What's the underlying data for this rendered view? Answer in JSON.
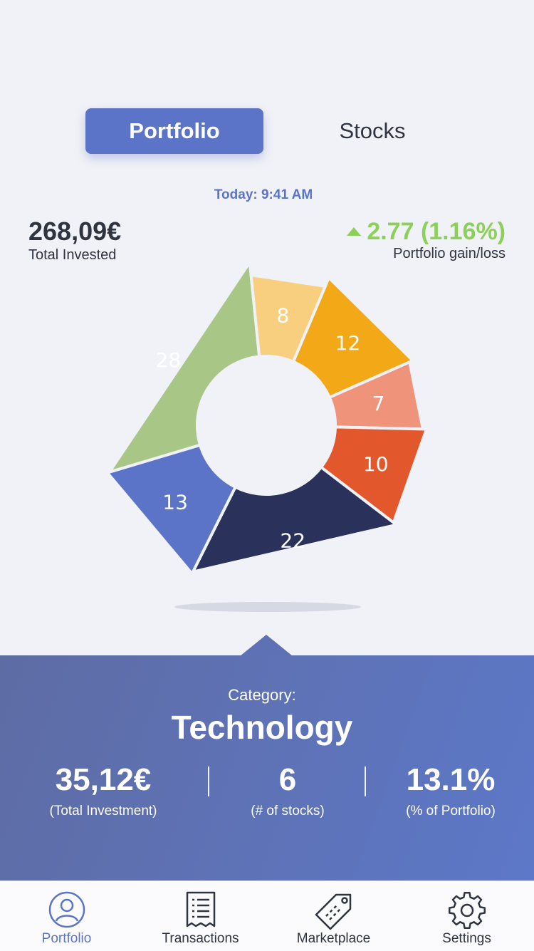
{
  "tabs": {
    "active": "Portfolio",
    "inactive": "Stocks"
  },
  "timestamp": "Today: 9:41 AM",
  "total": {
    "value": "268,09€",
    "label": "Total Invested"
  },
  "gain": {
    "value": "2.77 (1.16%)",
    "label": "Portfolio gain/loss",
    "color": "#8cd05a"
  },
  "chart_data": {
    "type": "pie",
    "style": "donut",
    "values": [
      12,
      7,
      10,
      22,
      13,
      28,
      8
    ],
    "colors": [
      "#f2a817",
      "#ef937b",
      "#e3572d",
      "#2a325c",
      "#5b74c8",
      "#a8c685",
      "#f8cf7f"
    ]
  },
  "category": {
    "label": "Category:",
    "name": "Technology",
    "stats": [
      {
        "value": "35,12€",
        "label": "(Total Investment)"
      },
      {
        "value": "6",
        "label": "(# of stocks)"
      },
      {
        "value": "13.1%",
        "label": "(% of Portfolio)"
      }
    ]
  },
  "nav": {
    "items": [
      {
        "label": "Portfolio",
        "icon": "user-icon",
        "active": true
      },
      {
        "label": "Transactions",
        "icon": "receipt-icon",
        "active": false
      },
      {
        "label": "Marketplace",
        "icon": "tag-icon",
        "active": false
      },
      {
        "label": "Settings",
        "icon": "gear-icon",
        "active": false
      }
    ]
  }
}
